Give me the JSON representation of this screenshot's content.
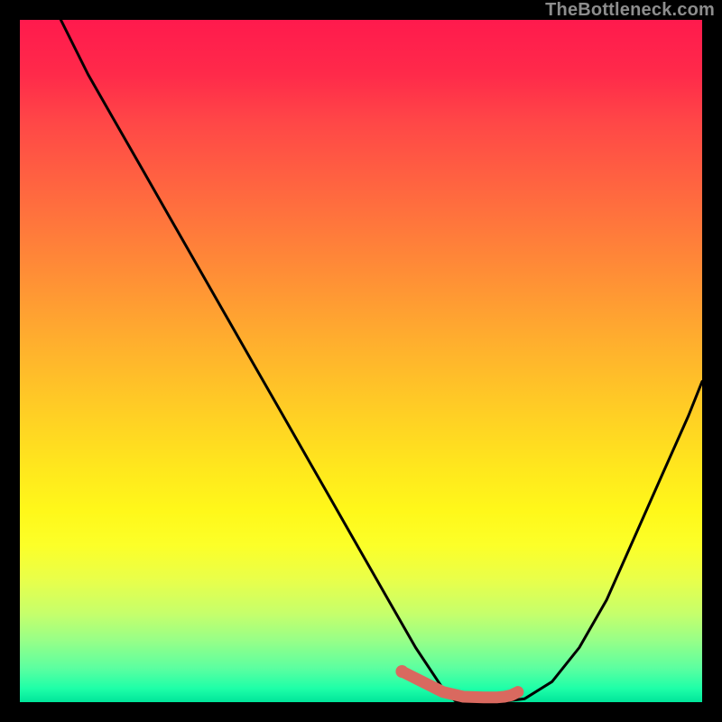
{
  "attribution": "TheBottleneck.com",
  "colors": {
    "curve_stroke": "#000000",
    "marker_stroke": "#d9695f",
    "marker_fill": "#d9695f"
  },
  "chart_data": {
    "type": "line",
    "title": "",
    "xlabel": "",
    "ylabel": "",
    "xlim": [
      0,
      100
    ],
    "ylim": [
      0,
      100
    ],
    "grid": false,
    "series": [
      {
        "name": "bottleneck-curve",
        "x": [
          6,
          10,
          14,
          18,
          22,
          26,
          30,
          34,
          38,
          42,
          46,
          50,
          54,
          58,
          62,
          64,
          66,
          70,
          74,
          78,
          82,
          86,
          90,
          94,
          98,
          100
        ],
        "values": [
          100,
          92,
          85,
          78,
          71,
          64,
          57,
          50,
          43,
          36,
          29,
          22,
          15,
          8,
          2,
          0,
          0,
          0,
          0.5,
          3,
          8,
          15,
          24,
          33,
          42,
          47
        ]
      }
    ],
    "markers": {
      "name": "highlight-segment",
      "x": [
        56,
        62,
        65,
        68,
        70,
        71,
        72,
        73
      ],
      "values": [
        4.5,
        1.5,
        0.8,
        0.7,
        0.7,
        0.8,
        1.0,
        1.5
      ]
    }
  }
}
